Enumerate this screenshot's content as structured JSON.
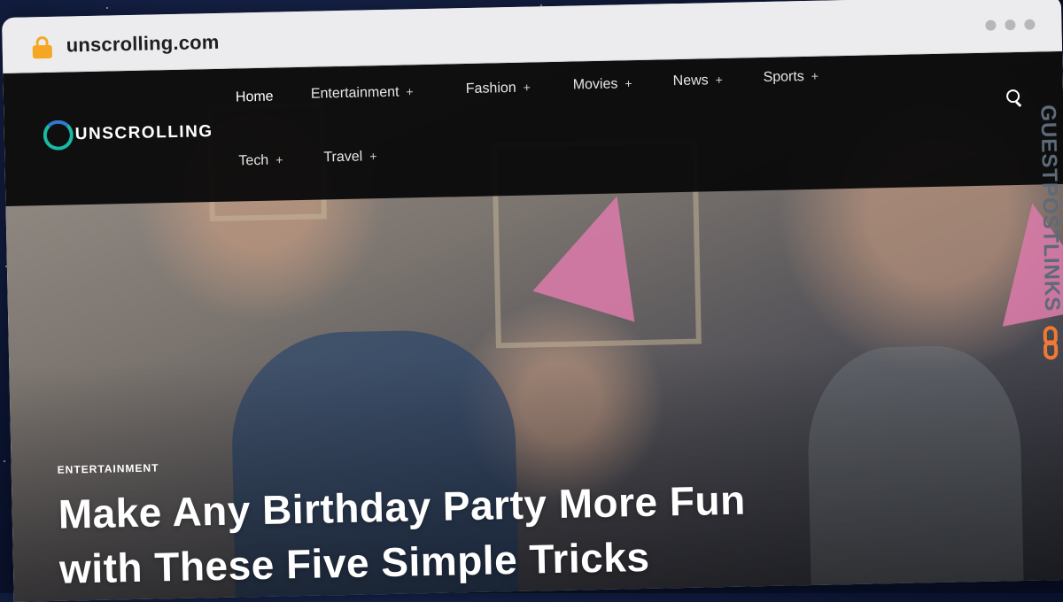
{
  "browser": {
    "url": "unscrolling.com"
  },
  "site": {
    "logo_text": "UNSCROLLING",
    "nav": [
      {
        "label": "Home",
        "has_submenu": false,
        "active": true
      },
      {
        "label": "Entertainment",
        "has_submenu": true
      },
      {
        "label": "Fashion",
        "has_submenu": true
      },
      {
        "label": "Movies",
        "has_submenu": true
      },
      {
        "label": "News",
        "has_submenu": true
      },
      {
        "label": "Sports",
        "has_submenu": true
      },
      {
        "label": "Tech",
        "has_submenu": true
      },
      {
        "label": "Travel",
        "has_submenu": true
      }
    ],
    "submenu_glyph": "+",
    "icons": {
      "search": "search-icon",
      "lock": "lock-icon"
    }
  },
  "hero": {
    "category": "ENTERTAINMENT",
    "title": "Make Any Birthday Party More Fun with These Five Simple Tricks"
  },
  "watermark": {
    "text": "GUESTPOSTLINKS"
  },
  "colors": {
    "nav_bg": "#0a0a0c",
    "logo_ring": "#1bb9a4",
    "lock": "#f5a623",
    "watermark_chain": "#f07a35"
  }
}
